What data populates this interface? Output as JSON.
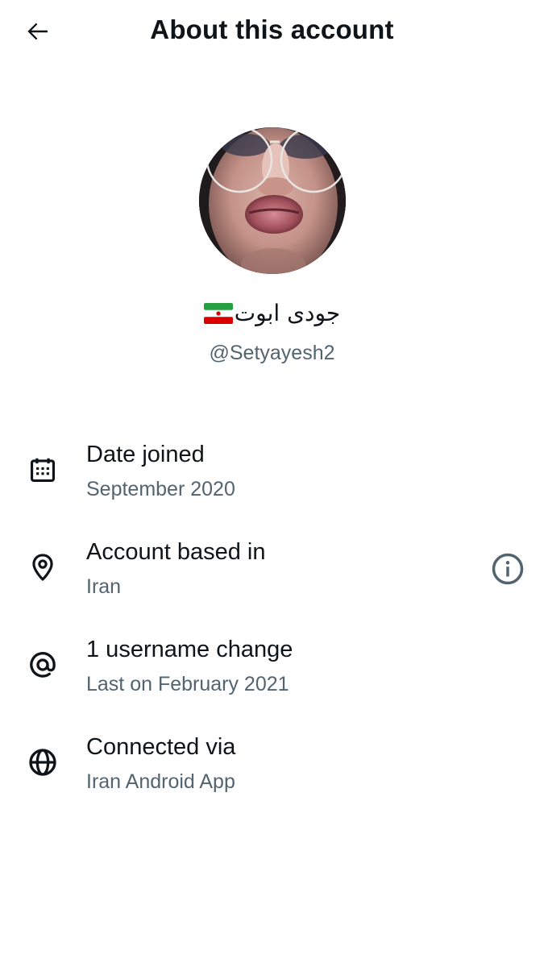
{
  "header": {
    "title": "About this account",
    "back_icon": "arrow-left-icon"
  },
  "profile": {
    "display_name": "جودی ابوت",
    "flag_icon": "iran-flag-icon",
    "handle": "@Setyayesh2"
  },
  "details": [
    {
      "icon": "calendar-icon",
      "label": "Date joined",
      "value": "September 2020"
    },
    {
      "icon": "location-pin-icon",
      "label": "Account based in",
      "value": "Iran",
      "extra_icon": "info-icon"
    },
    {
      "icon": "at-sign-icon",
      "label": "1 username change",
      "value": "Last on February 2021"
    },
    {
      "icon": "globe-icon",
      "label": "Connected via",
      "value": "Iran Android App"
    }
  ],
  "colors": {
    "text_primary": "#0f1419",
    "text_secondary": "#536471",
    "background": "#ffffff"
  }
}
